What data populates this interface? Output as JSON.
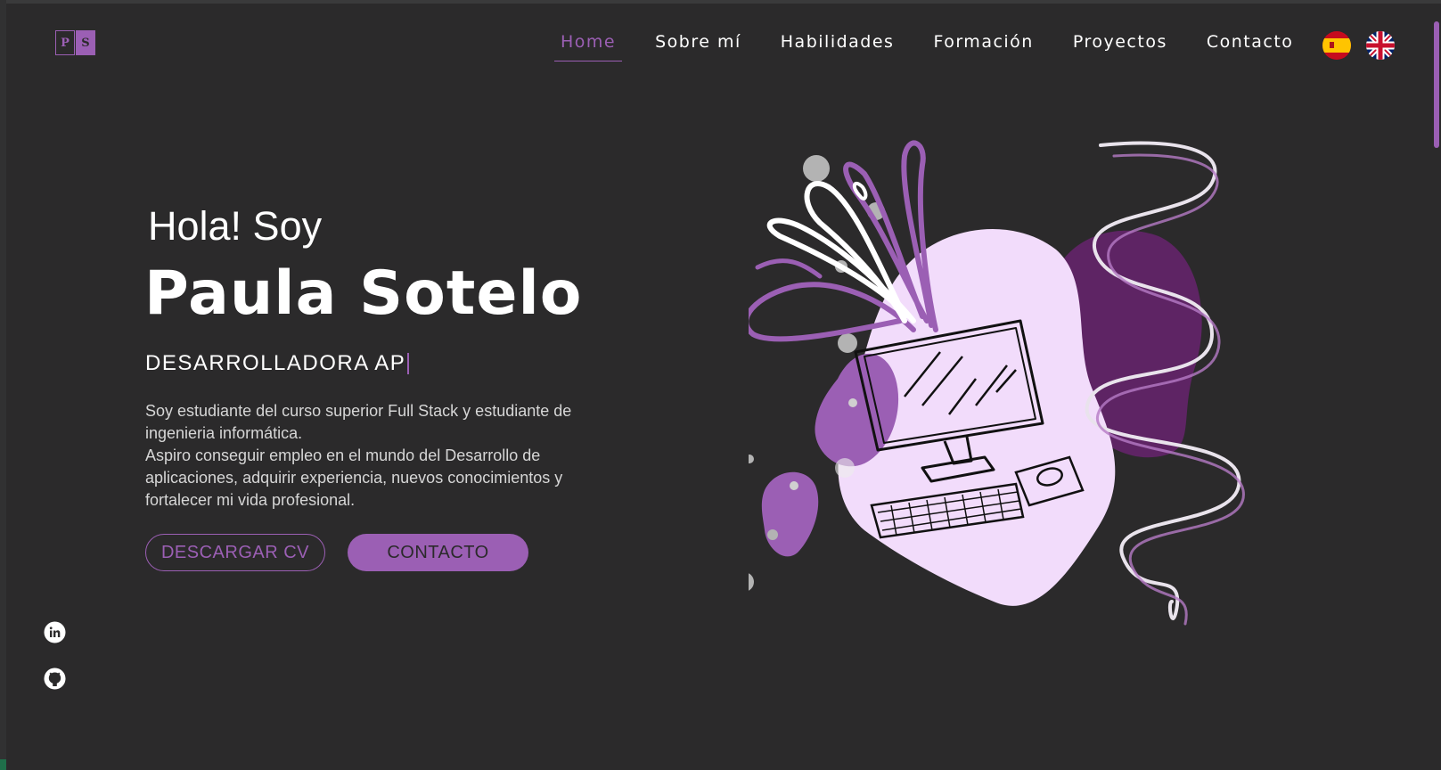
{
  "header": {
    "logo": {
      "left_letter": "P",
      "right_letter": "S"
    },
    "nav": [
      {
        "label": "Home",
        "active": true
      },
      {
        "label": "Sobre mí",
        "active": false
      },
      {
        "label": "Habilidades",
        "active": false
      },
      {
        "label": "Formación",
        "active": false
      },
      {
        "label": "Proyectos",
        "active": false
      },
      {
        "label": "Contacto",
        "active": false
      }
    ],
    "languages": [
      {
        "code": "es",
        "icon": "spain-flag-icon"
      },
      {
        "code": "en",
        "icon": "uk-flag-icon"
      }
    ]
  },
  "hero": {
    "greeting": "Hola! Soy",
    "name": "Paula Sotelo",
    "role": "DESARROLLADORA AP",
    "bio": [
      "Soy estudiante del curso superior Full Stack y estudiante de ingenieria informática.",
      "Aspiro conseguir empleo en el mundo del Desarrollo de aplicaciones, adquirir experiencia, nuevos conocimientos y fortalecer mi vida profesional."
    ],
    "buttons": {
      "cv": "DESCARGAR CV",
      "contact": "CONTACTO"
    },
    "illustration": "computer-illustration"
  },
  "social": [
    {
      "icon": "linkedin-icon"
    },
    {
      "icon": "github-icon"
    }
  ],
  "colors": {
    "accent": "#9b5fb4",
    "background": "#2b2a2b",
    "blob_light": "#f2dcfb",
    "blob_dark": "#5e2464"
  }
}
